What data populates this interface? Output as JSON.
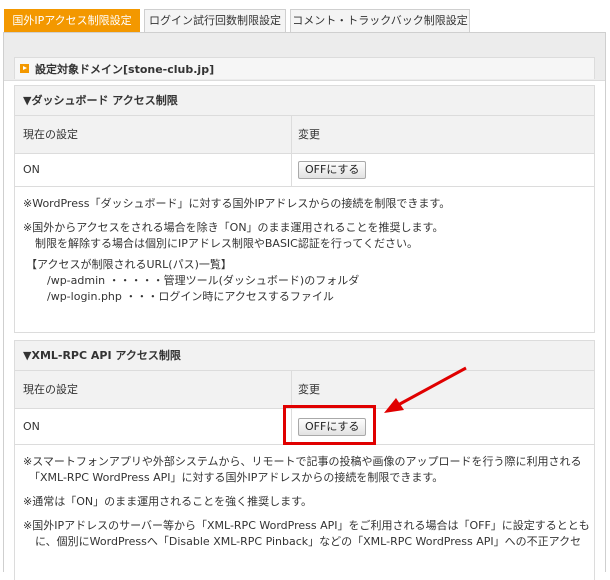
{
  "tabs": [
    {
      "label": "国外IPアクセス制限設定",
      "active": true
    },
    {
      "label": "ログイン試行回数制限設定",
      "active": false
    },
    {
      "label": "コメント・トラックバック制限設定",
      "active": false
    }
  ],
  "domain_label": "設定対象ドメイン[stone-club.jp]",
  "dashboard": {
    "title": "▼ダッシュボード アクセス制限",
    "col_current": "現在の設定",
    "col_change": "変更",
    "current_value": "ON",
    "button_label": "OFFにする",
    "notes": [
      "※WordPress「ダッシュボード」に対する国外IPアドレスからの接続を制限できます。",
      "※国外からアクセスをされる場合を除き「ON」のまま運用されることを推奨します。",
      "制限を解除する場合は個別にIPアドレス制限やBASIC認証を行ってください。",
      "【アクセスが制限されるURL(パス)一覧】",
      "/wp-admin ・・・・・管理ツール(ダッシュボード)のフォルダ",
      "/wp-login.php ・・・ログイン時にアクセスするファイル"
    ]
  },
  "xmlrpc": {
    "title": "▼XML-RPC API アクセス制限",
    "col_current": "現在の設定",
    "col_change": "変更",
    "current_value": "ON",
    "button_label": "OFFにする",
    "notes": [
      "※スマートフォンアプリや外部システムから、リモートで記事の投稿や画像のアップロードを行う際に利用される",
      "「XML-RPC WordPress API」に対する国外IPアドレスからの接続を制限できます。",
      "※通常は「ON」のまま運用されることを強く推奨します。",
      "※国外IPアドレスのサーバー等から「XML-RPC WordPress API」をご利用される場合は「OFF」に設定するととも",
      "に、個別にWordPressへ「Disable XML-RPC Pinback」などの「XML-RPC WordPress API」への不正アクセ"
    ]
  },
  "colors": {
    "accent": "#f39800",
    "highlight": "#e00000"
  }
}
